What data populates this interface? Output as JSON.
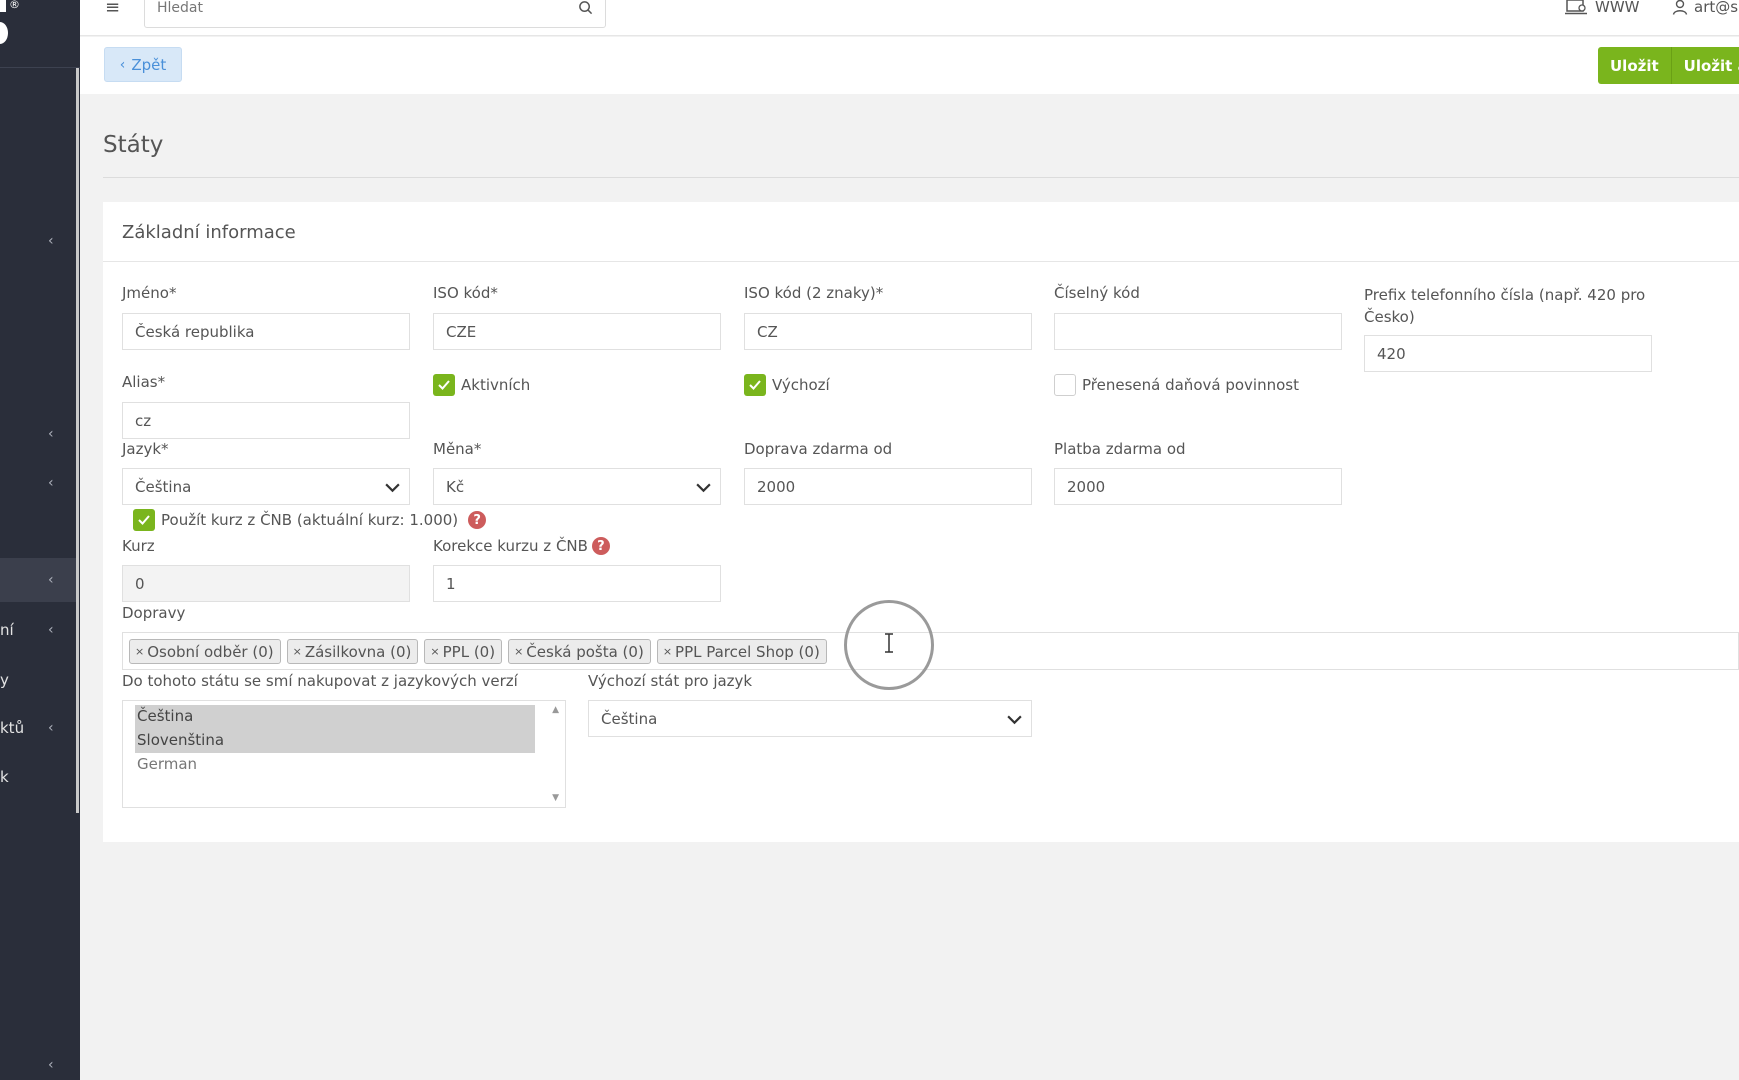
{
  "topbar": {
    "search_placeholder": "Hledat",
    "www_label": "WWW",
    "user_label": "art@s"
  },
  "sidebar": {
    "items": [
      {
        "label": "",
        "active": false
      },
      {
        "label": "",
        "active": false
      },
      {
        "label": "",
        "active": false
      },
      {
        "label": "",
        "active": true
      },
      {
        "label": "ní",
        "active": false
      },
      {
        "label": "y",
        "active": false
      },
      {
        "label": "ktů",
        "active": false
      },
      {
        "label": "k",
        "active": false
      },
      {
        "label": "",
        "active": false
      }
    ]
  },
  "actions": {
    "back_label": "Zpět",
    "save_label": "Uložit",
    "save_close_label": "Uložit a z"
  },
  "page": {
    "title": "Státy",
    "card_title": "Základní informace"
  },
  "form": {
    "name_label": "Jméno*",
    "name_value": "Česká republika",
    "iso_label": "ISO kód*",
    "iso_value": "CZE",
    "iso2_label": "ISO kód (2 znaky)*",
    "iso2_value": "CZ",
    "numeric_label": "Číselný kód",
    "numeric_value": "",
    "phone_prefix_label": "Prefix telefonního čísla (např. 420 pro Česko)",
    "phone_prefix_value": "420",
    "alias_label": "Alias*",
    "alias_value": "cz",
    "active_label": "Aktivních",
    "active_checked": true,
    "default_label": "Výchozí",
    "default_checked": true,
    "reverse_charge_label": "Přenesená daňová povinnost",
    "reverse_charge_checked": false,
    "language_label": "Jazyk*",
    "language_value": "Čeština",
    "currency_label": "Měna*",
    "currency_value": "Kč",
    "free_shipping_label": "Doprava zdarma od",
    "free_shipping_value": "2000",
    "free_payment_label": "Platba zdarma od",
    "free_payment_value": "2000",
    "cnb_rate_label": "Použít kurz z ČNB (aktuální kurz: 1.000)",
    "cnb_rate_checked": true,
    "rate_label": "Kurz",
    "rate_value": "0",
    "rate_correction_label": "Korekce kurzu z ČNB",
    "rate_correction_value": "1",
    "shipping_label": "Dopravy",
    "shipping_tags": [
      "Osobní odběr (0)",
      "Zásilkovna (0)",
      "PPL (0)",
      "Česká pošta (0)",
      "PPL Parcel Shop (0)"
    ],
    "lang_versions_label": "Do tohoto státu se smí nakupovat z jazykových verzí",
    "lang_versions": [
      "Čeština",
      "Slovenština",
      "German"
    ],
    "default_country_label": "Výchozí stát pro jazyk",
    "default_country_value": "Čeština"
  },
  "colors": {
    "accent_green": "#7ab51d",
    "sidebar_bg": "#2a2e3a",
    "back_button_bg": "#d8e8f8",
    "help_icon": "#cd5c5c"
  }
}
